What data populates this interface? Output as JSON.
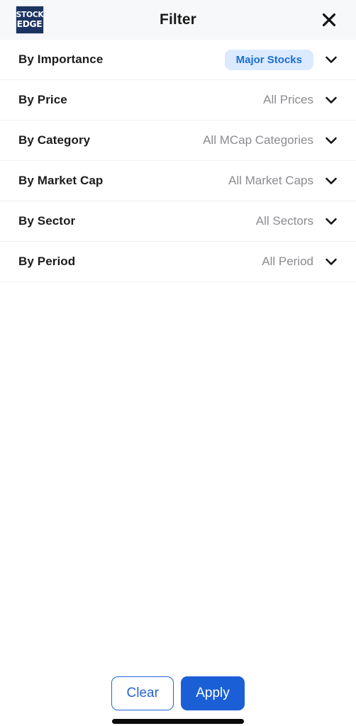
{
  "app": {
    "logo": {
      "line1": "STOCK",
      "line2": "EDGE",
      "background_color": "#1c3461",
      "text_color": "#ffffff"
    }
  },
  "header": {
    "title": "Filter",
    "close_icon": "close-icon",
    "background_color": "#f7f8fa"
  },
  "filters": [
    {
      "label": "By Importance",
      "value": "Major Stocks",
      "highlighted": true,
      "pill_background": "#dbeafe",
      "pill_text_color": "#1a6fd4",
      "chevron_icon": "chevron-down-icon"
    },
    {
      "label": "By Price",
      "value": "All Prices",
      "highlighted": false,
      "chevron_icon": "chevron-down-icon"
    },
    {
      "label": "By Category",
      "value": "All MCap Categories",
      "highlighted": false,
      "chevron_icon": "chevron-down-icon"
    },
    {
      "label": "By Market Cap",
      "value": "All Market Caps",
      "highlighted": false,
      "chevron_icon": "chevron-down-icon"
    },
    {
      "label": "By Sector",
      "value": "All Sectors",
      "highlighted": false,
      "chevron_icon": "chevron-down-icon"
    },
    {
      "label": "By Period",
      "value": "All Period",
      "highlighted": false,
      "chevron_icon": "chevron-down-icon"
    }
  ],
  "footer": {
    "clear_label": "Clear",
    "apply_label": "Apply",
    "clear_color": "#2563d9",
    "apply_background": "#1b5fd6",
    "apply_text_color": "#ffffff"
  },
  "system": {
    "home_indicator_color": "#0b0b0b"
  }
}
